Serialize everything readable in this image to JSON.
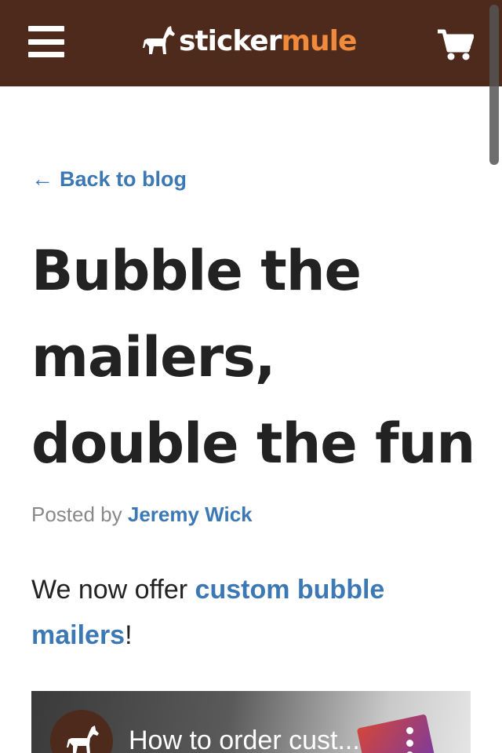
{
  "header": {
    "logo": {
      "word1": "sticker",
      "word2": "mule"
    },
    "menu_icon": "hamburger-menu-icon",
    "cart_icon": "shopping-cart-icon",
    "colors": {
      "background": "#4d2a1c",
      "logo_accent": "#f08a3c"
    }
  },
  "nav": {
    "back_arrow": "←",
    "back_label": "Back to blog"
  },
  "post": {
    "title": "Bubble the mailers, double the fun",
    "byline_prefix": "Posted by",
    "author": "Jeremy Wick",
    "intro_before": "We now offer",
    "intro_link": "custom bubble mailers",
    "intro_after": "!"
  },
  "video": {
    "title": "How to order cust...",
    "channel_icon": "mule-logo-icon",
    "more_icon": "more-vertical-icon"
  },
  "colors": {
    "link": "#3c78b4",
    "text": "#222222",
    "muted": "#888888"
  }
}
